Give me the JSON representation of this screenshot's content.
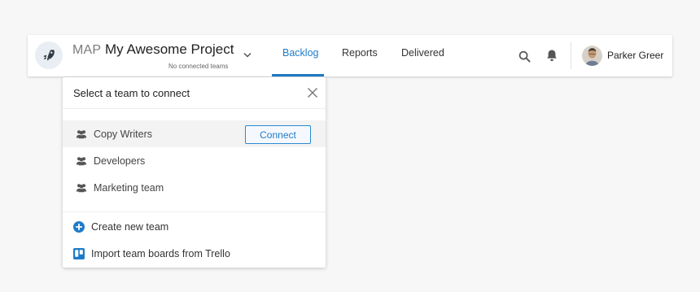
{
  "header": {
    "project_key": "MAP",
    "project_name": "My Awesome Project",
    "project_subtitle": "No connected teams",
    "tabs": [
      {
        "label": "Backlog",
        "active": true
      },
      {
        "label": "Reports",
        "active": false
      },
      {
        "label": "Delivered",
        "active": false
      }
    ],
    "user_name": "Parker Greer",
    "icons": {
      "logo": "rocket-icon",
      "chevron": "chevron-down-icon",
      "search": "search-icon",
      "notifications": "bell-icon"
    }
  },
  "dropdown": {
    "title": "Select a team to connect",
    "close_icon": "close-icon",
    "teams": [
      {
        "name": "Copy Writers",
        "icon": "team-icon",
        "highlighted": true
      },
      {
        "name": "Developers",
        "icon": "team-icon",
        "highlighted": false
      },
      {
        "name": "Marketing team",
        "icon": "team-icon",
        "highlighted": false
      }
    ],
    "connect_label": "Connect",
    "actions": [
      {
        "label": "Create new team",
        "icon": "plus-circle-icon"
      },
      {
        "label": "Import team boards from Trello",
        "icon": "trello-icon"
      }
    ]
  },
  "colors": {
    "accent": "#1f7bc8",
    "page_background": "#f7f7f7",
    "panel_background": "#ffffff"
  }
}
